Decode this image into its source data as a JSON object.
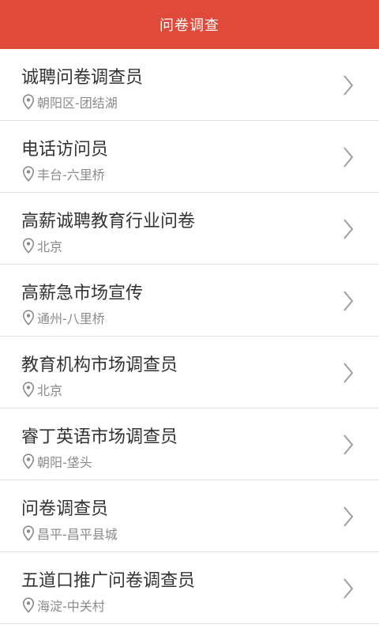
{
  "header": {
    "title": "问卷调查"
  },
  "colors": {
    "header_bg": "#df4a3a",
    "title_text": "#333333",
    "location_text": "#8a8a8a",
    "divider": "#e3e3e3"
  },
  "icons": {
    "location": "location-pin-icon",
    "chevron": "chevron-right-icon"
  },
  "jobs": [
    {
      "title": "诚聘问卷调查员",
      "location": "朝阳区-团结湖"
    },
    {
      "title": "电话访问员",
      "location": "丰台-六里桥"
    },
    {
      "title": "高薪诚聘教育行业问卷",
      "location": "北京"
    },
    {
      "title": "高薪急市场宣传",
      "location": "通州-八里桥"
    },
    {
      "title": "教育机构市场调查员",
      "location": "北京"
    },
    {
      "title": "睿丁英语市场调查员",
      "location": "朝阳-垡头"
    },
    {
      "title": "问卷调查员",
      "location": "昌平-昌平县城"
    },
    {
      "title": "五道口推广问卷调查员",
      "location": "海淀-中关村"
    }
  ]
}
